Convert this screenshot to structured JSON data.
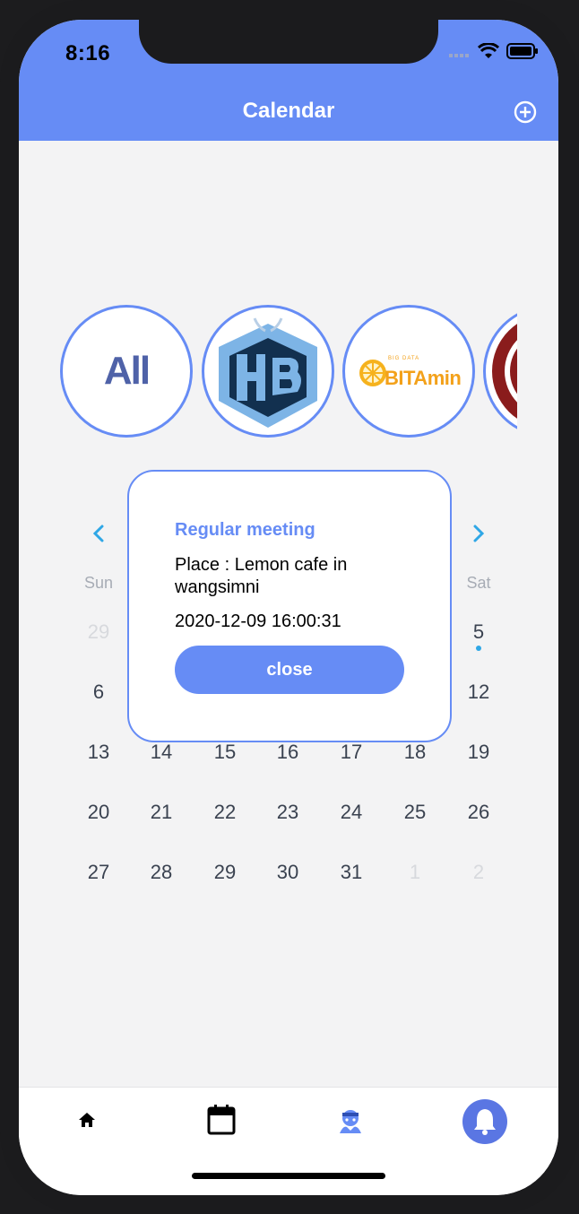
{
  "status_bar": {
    "time": "8:16"
  },
  "header": {
    "title": "Calendar",
    "add_icon": "plus-circle-icon"
  },
  "clubs": [
    {
      "id": "all",
      "label": "All"
    },
    {
      "id": "htb",
      "logo": "HTB"
    },
    {
      "id": "bitamin",
      "logo": "BITAmin"
    },
    {
      "id": "sunday",
      "logo": "Sunday"
    }
  ],
  "calendar": {
    "weekdays": [
      "Sun",
      "Sat"
    ],
    "rows": [
      [
        "29",
        "5"
      ],
      [
        "6",
        "12"
      ],
      [
        "13",
        "14",
        "15",
        "16",
        "17",
        "18",
        "19"
      ],
      [
        "20",
        "21",
        "22",
        "23",
        "24",
        "25",
        "26"
      ],
      [
        "27",
        "28",
        "29",
        "30",
        "31",
        "1",
        "2"
      ]
    ]
  },
  "modal": {
    "title": "Regular meeting",
    "place": "Place : Lemon cafe in wangsimni",
    "datetime": "2020-12-09 16:00:31",
    "close_label": "close"
  },
  "tabbar": {
    "items": [
      "home-icon",
      "calendar-icon",
      "club-icon",
      "bell-icon"
    ],
    "active": "bell-icon"
  },
  "colors": {
    "accent": "#668cf5",
    "dot": "#2fa7e6",
    "muted_day": "#d7d9dd"
  }
}
